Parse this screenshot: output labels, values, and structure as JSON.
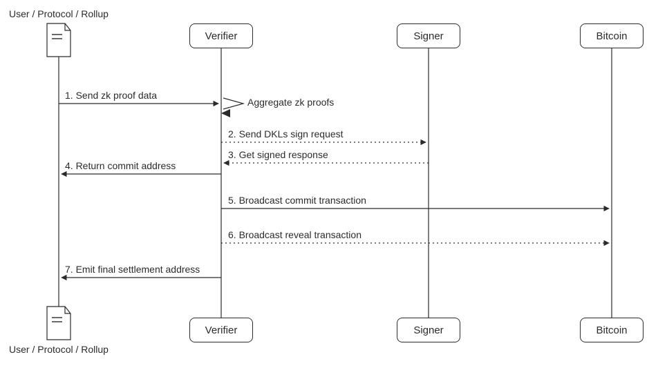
{
  "chart_data": {
    "type": "sequence-diagram",
    "participants": [
      {
        "id": "user",
        "label": "User / Protocol / Rollup",
        "kind": "document"
      },
      {
        "id": "verifier",
        "label": "Verifier",
        "kind": "box"
      },
      {
        "id": "signer",
        "label": "Signer",
        "kind": "box"
      },
      {
        "id": "bitcoin",
        "label": "Bitcoin",
        "kind": "box"
      }
    ],
    "self_message": {
      "at": "verifier",
      "label": "Aggregate zk proofs"
    },
    "messages": [
      {
        "n": 1,
        "from": "user",
        "to": "verifier",
        "label": "1. Send zk proof data",
        "style": "solid"
      },
      {
        "n": 2,
        "from": "verifier",
        "to": "signer",
        "label": "2. Send DKLs sign request",
        "style": "dotted"
      },
      {
        "n": 3,
        "from": "signer",
        "to": "verifier",
        "label": "3. Get signed response",
        "style": "dotted"
      },
      {
        "n": 4,
        "from": "verifier",
        "to": "user",
        "label": "4. Return commit address",
        "style": "solid"
      },
      {
        "n": 5,
        "from": "verifier",
        "to": "bitcoin",
        "label": "5. Broadcast commit transaction",
        "style": "solid"
      },
      {
        "n": 6,
        "from": "verifier",
        "to": "bitcoin",
        "label": "6. Broadcast reveal transaction",
        "style": "dotted"
      },
      {
        "n": 7,
        "from": "verifier",
        "to": "user",
        "label": "7. Emit final settlement address",
        "style": "solid"
      }
    ]
  },
  "participants": {
    "user": {
      "label": "User / Protocol / Rollup"
    },
    "verifier": {
      "label": "Verifier"
    },
    "signer": {
      "label": "Signer"
    },
    "bitcoin": {
      "label": "Bitcoin"
    }
  },
  "self_message_label": "Aggregate zk proofs",
  "messages": {
    "m1": "1. Send zk proof data",
    "m2": "2. Send DKLs sign request",
    "m3": "3. Get signed response",
    "m4": "4. Return commit address",
    "m5": "5. Broadcast commit transaction",
    "m6": "6. Broadcast reveal transaction",
    "m7": "7. Emit final settlement address"
  }
}
